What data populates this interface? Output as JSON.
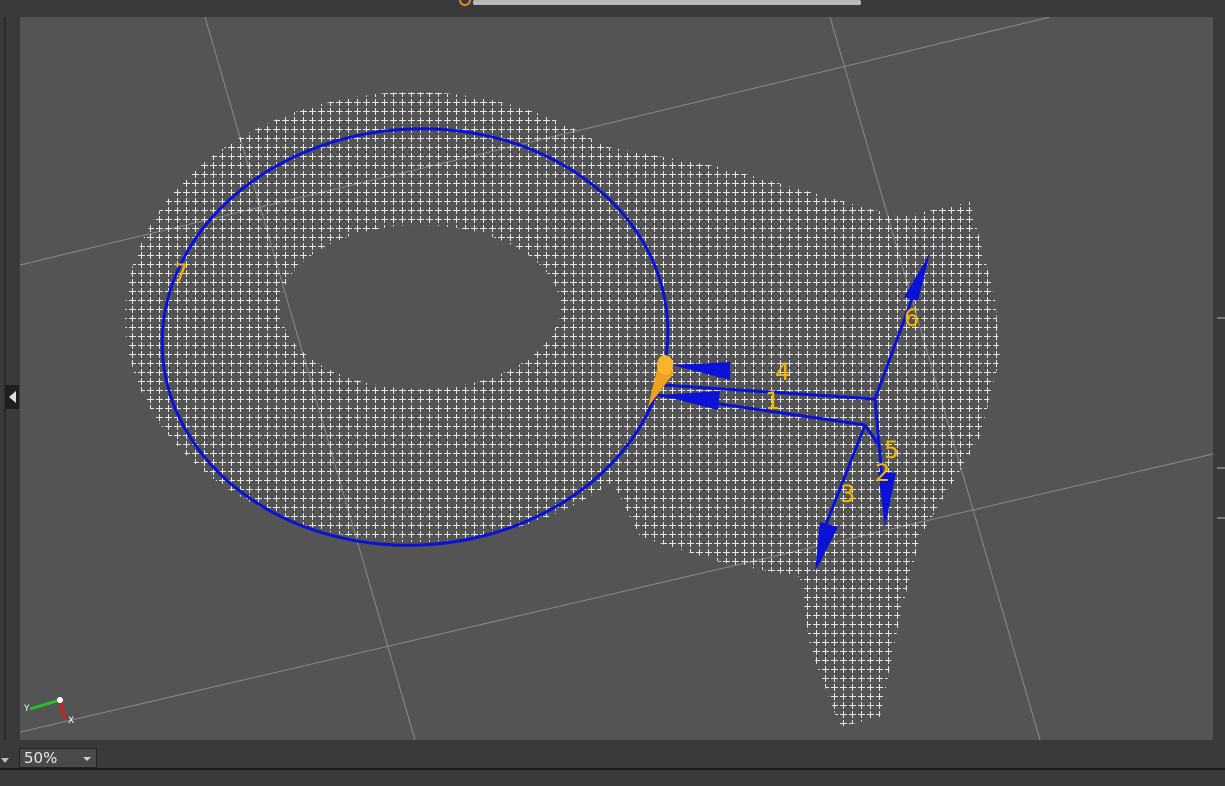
{
  "viewport": {
    "path_labels": [
      "1",
      "2",
      "3",
      "4",
      "5",
      "6",
      "7"
    ],
    "colors": {
      "background": "#545454",
      "point_cloud": "#e6e6e6",
      "path": "#0a12d8",
      "label": "#f2b800",
      "tool": "#f0a020"
    },
    "axis_gizmo": {
      "x_label": "X",
      "y_label": "Y"
    }
  },
  "statusbar": {
    "zoom_value": "50%"
  }
}
